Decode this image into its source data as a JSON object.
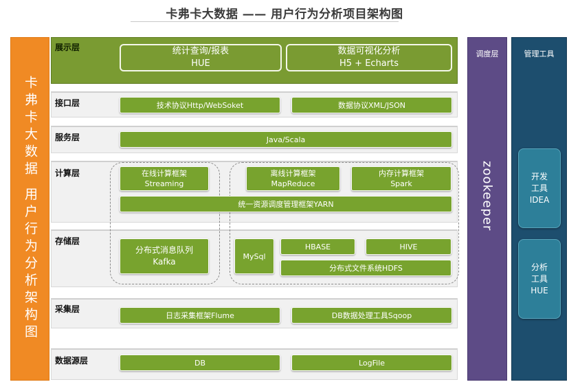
{
  "title": "卡弗卡大数据 —— 用户行为分析项目架构图",
  "left_label": "卡弗卡大数据 用户行为分析架构图",
  "layers": {
    "display": {
      "label": "展示层",
      "items": [
        {
          "line1": "统计查询/报表",
          "line2": "HUE"
        },
        {
          "line1": "数据可视化分析",
          "line2": "H5 + Echarts"
        }
      ]
    },
    "interface": {
      "label": "接口层",
      "items": [
        "技术协议Http/WebSoket",
        "数据协议XML/JSON"
      ]
    },
    "service": {
      "label": "服务层",
      "items": [
        "Java/Scala"
      ]
    },
    "compute": {
      "label": "计算层",
      "items": [
        {
          "line1": "在线计算框架",
          "line2": "Streaming"
        },
        {
          "line1": "离线计算框架",
          "line2": "MapReduce"
        },
        {
          "line1": "内存计算框架",
          "line2": "Spark"
        }
      ],
      "yarn": "统一资源调度管理框架YARN"
    },
    "storage": {
      "label": "存储层",
      "kafka": {
        "line1": "分布式消息队列",
        "line2": "Kafka"
      },
      "mysql": "MySql",
      "hbase": "HBASE",
      "hive": "HIVE",
      "hdfs": "分布式文件系统HDFS"
    },
    "collect": {
      "label": "采集层",
      "items": [
        "日志采集框架Flume",
        "DB数据处理工具Sqoop"
      ]
    },
    "source": {
      "label": "数据源层",
      "items": [
        "DB",
        "LogFile"
      ]
    }
  },
  "scheduling": {
    "title": "调度层",
    "item": "zookeeper"
  },
  "management": {
    "title": "管理工具",
    "tools": [
      {
        "line1": "开发",
        "line2": "工具",
        "line3": "IDEA"
      },
      {
        "line1": "分析",
        "line2": "工具",
        "line3": "HUE"
      }
    ]
  },
  "colors": {
    "orange": "#f08a24",
    "green": "#78a32e",
    "display_green": "#7a9b32",
    "purple": "#5d4b86",
    "navy": "#1d4e6e",
    "teal": "#2d7f99"
  }
}
